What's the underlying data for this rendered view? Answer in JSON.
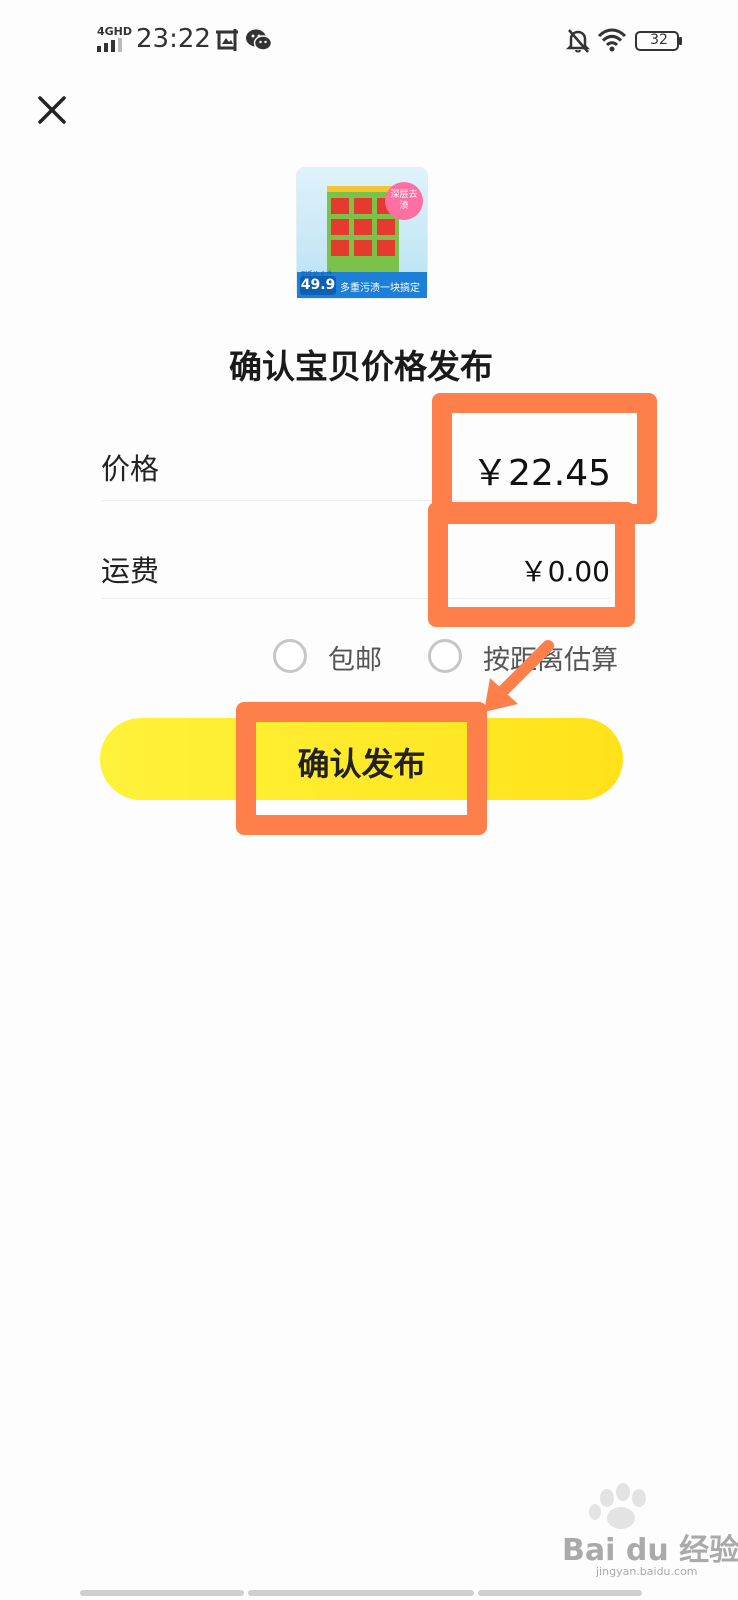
{
  "status_bar": {
    "network": "4GHD",
    "time": "23:22",
    "battery": "32",
    "icons": [
      "signal-icon",
      "screenshot-icon",
      "wechat-icon",
      "mute-icon",
      "wifi-icon",
      "battery-icon"
    ]
  },
  "product": {
    "badge": "深层去渍",
    "price": "49.9",
    "slogan": "多重污渍一块搞定",
    "promo_small": "到手价 6 件"
  },
  "title": "确认宝贝价格发布",
  "form": {
    "price_label": "价格",
    "price_value": "￥22.45",
    "freight_label": "运费",
    "freight_value": "￥0.00",
    "shipping_options": [
      "包邮",
      "按距离估算"
    ]
  },
  "confirm_button": "确认发布",
  "watermark": {
    "logo": "Bai du 经验",
    "url": "jingyan.baidu.com"
  },
  "colors": {
    "annotation": "#ff7f4a",
    "button": "#ffe21a",
    "background": "#fdfdfd"
  }
}
